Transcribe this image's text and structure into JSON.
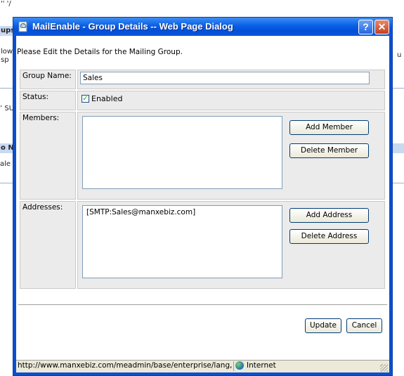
{
  "background": {
    "fragments": [
      "'' '/",
      "ups",
      "low",
      "sp",
      "u",
      "’ SU",
      "o N",
      "ale"
    ]
  },
  "window": {
    "title": "MailEnable - Group Details -- Web Page Dialog",
    "help_label": "?",
    "close_label": "✕"
  },
  "intro": "Please Edit the Details for the Mailing Group.",
  "form": {
    "group_name_label": "Group Name:",
    "group_name_value": "Sales",
    "status_label": "Status:",
    "status_checked": true,
    "status_check_mark": "✓",
    "status_text": "Enabled",
    "members_label": "Members:",
    "members": [],
    "add_member_label": "Add Member",
    "delete_member_label": "Delete Member",
    "addresses_label": "Addresses:",
    "addresses": [
      "[SMTP:Sales@manxebiz.com]"
    ],
    "add_address_label": "Add Address",
    "delete_address_label": "Delete Address"
  },
  "actions": {
    "update_label": "Update",
    "cancel_label": "Cancel"
  },
  "statusbar": {
    "url": "http://www.manxebiz.com/meadmin/base/enterprise/lang,",
    "zone": "Internet"
  },
  "icons": {
    "title_icon": "ie-page-icon",
    "zone_icon": "globe-icon"
  }
}
